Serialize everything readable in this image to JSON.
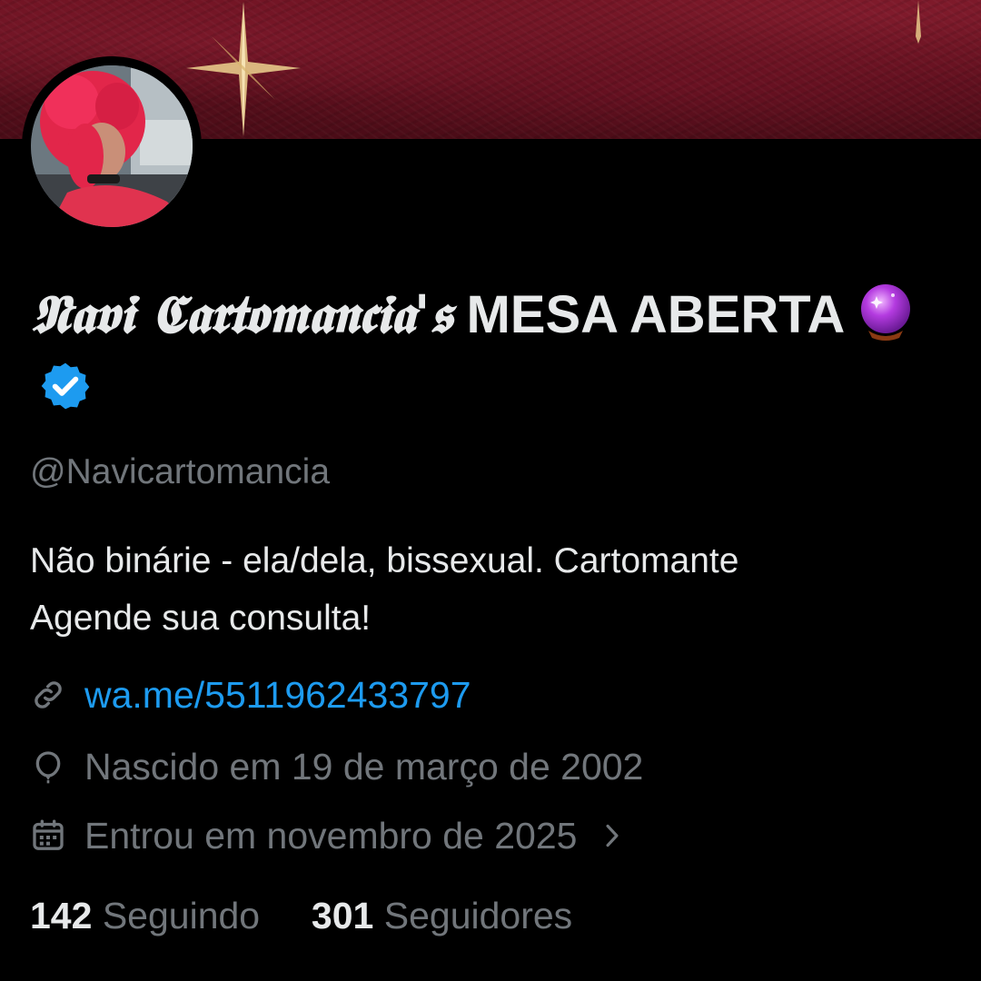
{
  "profile": {
    "name_stylized": "𝕹𝖆𝖛𝖎 𝕮𝖆𝖗𝖙𝖔𝖒𝖆𝖓𝖈𝖎𝖆'𝖘",
    "name_plain": "MESA ABERTA",
    "name_emoji": "crystal-ball-icon",
    "verified_icon": "verified-badge-icon",
    "handle": "@Navicartomancia",
    "bio_lines": [
      "Não binárie - ela/dela, bissexual. Cartomante",
      "Agende sua consulta!"
    ],
    "link": {
      "icon": "link-icon",
      "text": "wa.me/5511962433797"
    },
    "birthday": {
      "icon": "balloon-icon",
      "text": "Nascido em 19 de março de 2002"
    },
    "joined": {
      "icon": "calendar-icon",
      "text": "Entrou em novembro de 2025",
      "chevron": "chevron-right-icon"
    },
    "following": {
      "count": "142",
      "label": "Seguindo"
    },
    "followers": {
      "count": "301",
      "label": "Seguidores"
    }
  },
  "colors": {
    "background": "#000000",
    "primary_text": "#e7e9ea",
    "secondary_text": "#71767b",
    "link": "#1d9bf0",
    "verified": "#1d9bf0",
    "banner": "#6e1322"
  }
}
